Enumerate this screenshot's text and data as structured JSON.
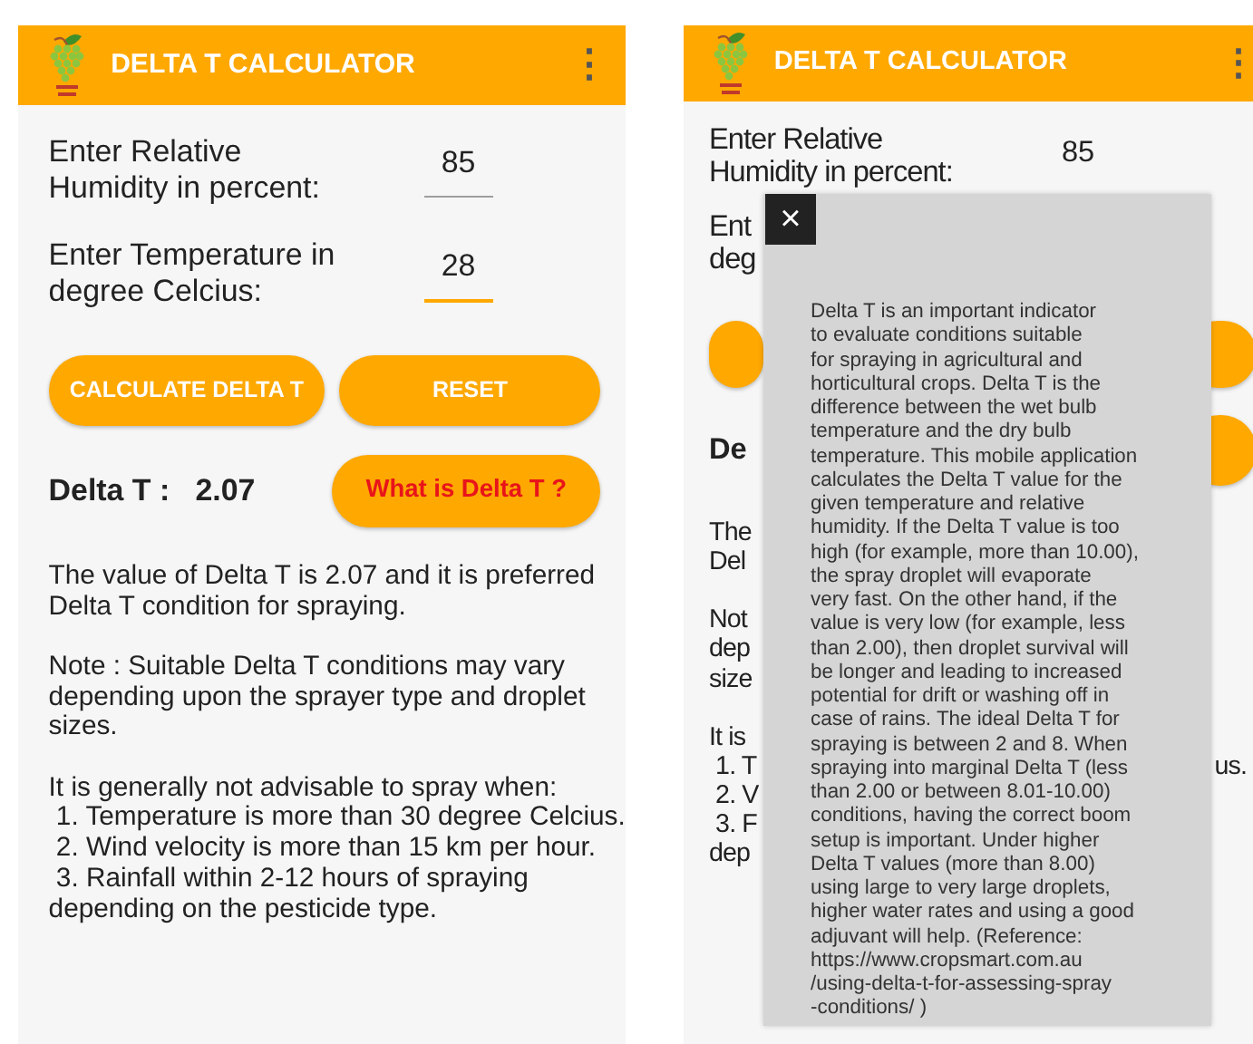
{
  "screens": [
    {
      "app_bar": {
        "title": "DELTA T CALCULATOR",
        "menu": "⋮"
      },
      "fields": [
        {
          "label_lines": [
            "Enter Relative",
            "Humidity in percent:"
          ],
          "value": "85",
          "focused": false
        },
        {
          "label_lines": [
            "Enter Temperature in",
            "degree Celcius:"
          ],
          "value": "28",
          "focused": true
        }
      ],
      "buttons": [
        {
          "kind": "full",
          "label": "CALCULATE DELTA T"
        },
        {
          "kind": "full",
          "label": "RESET"
        }
      ],
      "result": {
        "label": "Delta T :",
        "value": "2.07"
      },
      "help_button": {
        "kind": "full",
        "label": "What is Delta T ?"
      },
      "paragraphs": [
        {
          "lines": [
            "The value of Delta T is 2.07 and it is preferred",
            "Delta T condition for spraying."
          ]
        },
        {
          "lines": [
            "Note : Suitable Delta T conditions may vary",
            "depending upon the sprayer type and droplet",
            "sizes."
          ]
        },
        {
          "lines": [
            "It is generally not advisable to spray when:",
            " 1. Temperature is more than 30 degree Celcius.",
            " 2. Wind velocity is more than 15 km per hour.",
            " 3. Rainfall within 2-12 hours of spraying",
            "depending on the pesticide type."
          ]
        }
      ]
    },
    {
      "app_bar": {
        "title": "DELTA T CALCULATOR",
        "menu": "⋮"
      },
      "fields": [
        {
          "label_lines": [
            "Enter Relative",
            "Humidity in percent:"
          ],
          "value": "85"
        },
        {
          "label_lines": [
            "Ent",
            "deg"
          ]
        }
      ],
      "buttons": [
        {
          "kind": "left_stub"
        },
        {
          "kind": "right_stub"
        }
      ],
      "result": {
        "label": "De"
      },
      "help_button": {
        "kind": "right_stub"
      },
      "paragraphs": [
        {
          "lines": [
            "The",
            "Del"
          ]
        },
        {
          "lines": [
            "Not",
            "dep",
            "size"
          ]
        },
        {
          "lines": [
            "It is",
            " 1. T",
            " 2. V",
            " 3. F",
            "dep"
          ],
          "side_text": "us."
        }
      ],
      "popup": {
        "close": "×",
        "lines": [
          "Delta T is an important indicator",
          "to evaluate conditions suitable",
          "for spraying in agricultural and",
          "horticultural crops. Delta T is the",
          "difference between the wet bulb",
          "temperature and the dry bulb",
          "temperature. This mobile application",
          "calculates the Delta T value for the",
          "given temperature and relative",
          "humidity. If the Delta T value is too",
          "high (for example, more than 10.00),",
          "the spray droplet will evaporate",
          "very fast. On the other hand, if the",
          "value is very low (for example, less",
          "than 2.00), then droplet survival will",
          "be longer and leading to increased",
          "potential for drift or washing off in",
          "case of rains. The ideal Delta T for",
          "spraying is between 2 and 8. When",
          "spraying into marginal Delta T (less",
          "than 2.00 or between 8.01-10.00)",
          "conditions, having the correct boom",
          "setup is important. Under higher",
          "Delta T values (more than 8.00)",
          "using large to very large droplets,",
          "higher water rates and using a good",
          "adjuvant will help. (Reference:",
          "https://www.cropsmart.com.au",
          "/using-delta-t-for-assessing-spray",
          "-conditions/ )"
        ]
      }
    }
  ]
}
